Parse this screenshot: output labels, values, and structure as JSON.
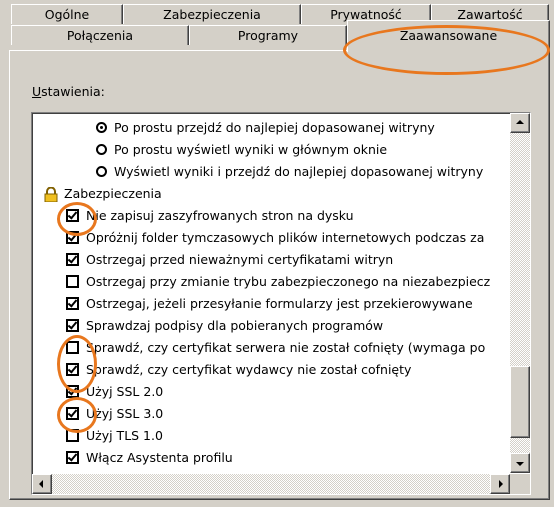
{
  "tabs": {
    "row1": [
      "Ogólne",
      "Zabezpieczenia",
      "Prywatność",
      "Zawartość"
    ],
    "row2": [
      "Połączenia",
      "Programy",
      "Zaawansowane"
    ]
  },
  "settings_label_u": "U",
  "settings_label_rest": "stawienia:",
  "items": [
    {
      "type": "radio",
      "checked": true,
      "label": "Po prostu przejdź do najlepiej dopasowanej witryny"
    },
    {
      "type": "radio",
      "checked": false,
      "label": "Po prostu wyświetl wyniki w głównym oknie"
    },
    {
      "type": "radio",
      "checked": false,
      "label": "Wyświetl wyniki i przejdź do najlepiej dopasowanej witryny"
    },
    {
      "type": "category",
      "label": "Zabezpieczenia",
      "icon": "lock-icon"
    },
    {
      "type": "checkbox",
      "checked": true,
      "label": "Nie zapisuj zaszyfrowanych stron na dysku"
    },
    {
      "type": "checkbox",
      "checked": true,
      "label": "Opróżnij folder tymczasowych plików internetowych podczas za"
    },
    {
      "type": "checkbox",
      "checked": true,
      "label": "Ostrzegaj przed nieważnymi certyfikatami witryn"
    },
    {
      "type": "checkbox",
      "checked": false,
      "label": "Ostrzegaj przy zmianie trybu zabezpieczonego na niezabezpiecz"
    },
    {
      "type": "checkbox",
      "checked": true,
      "label": "Ostrzegaj, jeżeli przesyłanie formularzy jest przekierowywane"
    },
    {
      "type": "checkbox",
      "checked": true,
      "label": "Sprawdzaj podpisy dla pobieranych programów"
    },
    {
      "type": "checkbox",
      "checked": false,
      "label": "Sprawdź, czy certyfikat serwera nie został cofnięty (wymaga po"
    },
    {
      "type": "checkbox",
      "checked": true,
      "label": "Sprawdź, czy certyfikat wydawcy nie został cofnięty"
    },
    {
      "type": "checkbox",
      "checked": true,
      "label": "Użyj SSL 2.0"
    },
    {
      "type": "checkbox",
      "checked": true,
      "label": "Użyj SSL 3.0"
    },
    {
      "type": "checkbox",
      "checked": false,
      "label": "Użyj TLS 1.0"
    },
    {
      "type": "checkbox",
      "checked": true,
      "label": "Włącz Asystenta profilu"
    }
  ],
  "annotation_color": "#e8771e"
}
